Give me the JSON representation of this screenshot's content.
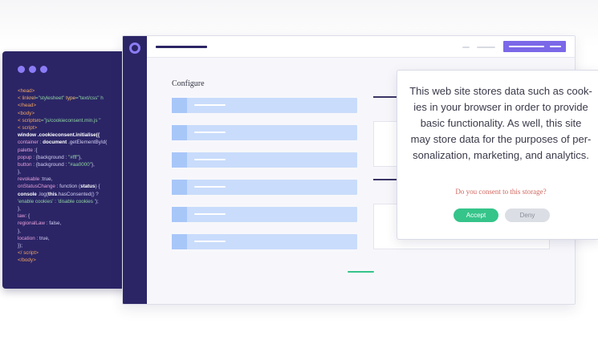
{
  "colors": {
    "navy": "#2b2566",
    "accent_purple": "#7b68e8",
    "dot_purple": "#8b7cf6",
    "row_blue": "#c9dcfb",
    "accept_green": "#35c48a",
    "deny_gray": "#dcdee5",
    "question_red": "#d0675e"
  },
  "code_editor": {
    "lines": [
      [
        {
          "t": "<head>",
          "c": "tag"
        }
      ],
      [
        {
          "t": "< ",
          "c": "tag"
        },
        {
          "t": "link",
          "c": "tag"
        },
        {
          "t": "rel",
          "c": "attr"
        },
        {
          "t": "=\"stylesheet\" ",
          "c": "str"
        },
        {
          "t": "type",
          "c": "attr"
        },
        {
          "t": "=\"text/css\" h",
          "c": "str"
        }
      ],
      [
        {
          "t": "</head>",
          "c": "tag"
        }
      ],
      [
        {
          "t": "<body>",
          "c": "tag"
        }
      ],
      [
        {
          "t": "< ",
          "c": "tag"
        },
        {
          "t": "script",
          "c": "tag"
        },
        {
          "t": "src",
          "c": "attr"
        },
        {
          "t": "=\"js/cookieconsent.min.js",
          "c": "str"
        },
        {
          "t": " \"",
          "c": "str"
        }
      ],
      [
        {
          "t": "< ",
          "c": "tag"
        },
        {
          "t": "script",
          "c": "tag"
        },
        {
          "t": ">",
          "c": "tag"
        }
      ],
      [
        {
          "t": "window",
          "c": "strong"
        },
        {
          "t": " .cookieconsent.initialise({",
          "c": "strong"
        }
      ],
      [
        {
          "t": "container",
          "c": "key"
        },
        {
          "t": " : ",
          "c": "plain"
        },
        {
          "t": "document",
          "c": "strong"
        },
        {
          "t": " .getElementById(",
          "c": "plain"
        }
      ],
      [
        {
          "t": "palette",
          "c": "key"
        },
        {
          "t": " :{",
          "c": "plain"
        }
      ],
      [
        {
          "t": "popup",
          "c": "key"
        },
        {
          "t": " : {background : ",
          "c": "plain"
        },
        {
          "t": "\"#fff\"",
          "c": "str"
        },
        {
          "t": "},",
          "c": "plain"
        }
      ],
      [
        {
          "t": "button",
          "c": "key"
        },
        {
          "t": " : {background : ",
          "c": "plain"
        },
        {
          "t": "\"#aa0000\"",
          "c": "str"
        },
        {
          "t": "},",
          "c": "plain"
        }
      ],
      [
        {
          "t": "},",
          "c": "plain"
        }
      ],
      [
        {
          "t": "revokable",
          "c": "key"
        },
        {
          "t": " :true,",
          "c": "plain"
        }
      ],
      [
        {
          "t": "onStatusChange",
          "c": "key"
        },
        {
          "t": " : function (",
          "c": "plain"
        },
        {
          "t": "status",
          "c": "strong"
        },
        {
          "t": ") {",
          "c": "plain"
        }
      ],
      [
        {
          "t": "console",
          "c": "strong"
        },
        {
          "t": " .log(",
          "c": "plain"
        },
        {
          "t": "this",
          "c": "strong"
        },
        {
          "t": ".hasConsented() ?",
          "c": "plain"
        }
      ],
      [
        {
          "t": "'enable cookies'",
          "c": "str"
        },
        {
          "t": " : ",
          "c": "plain"
        },
        {
          "t": "'disable cookies '",
          "c": "str"
        },
        {
          "t": ");",
          "c": "plain"
        }
      ],
      [
        {
          "t": "},",
          "c": "plain"
        }
      ],
      [
        {
          "t": "law",
          "c": "key"
        },
        {
          "t": ": {",
          "c": "plain"
        }
      ],
      [
        {
          "t": "regionalLaw",
          "c": "key"
        },
        {
          "t": " : false,",
          "c": "plain"
        }
      ],
      [
        {
          "t": "},",
          "c": "plain"
        }
      ],
      [
        {
          "t": "location",
          "c": "key"
        },
        {
          "t": " : true,",
          "c": "plain"
        }
      ],
      [
        {
          "t": "});",
          "c": "plain"
        }
      ],
      [
        {
          "t": "</ ",
          "c": "tag"
        },
        {
          "t": "script",
          "c": "tag"
        },
        {
          "t": ">",
          "c": "tag"
        }
      ],
      [
        {
          "t": "</body>",
          "c": "tag"
        }
      ]
    ]
  },
  "browser": {
    "configure_label": "Configure",
    "config_row_count": 6
  },
  "consent": {
    "message": "This web site stores data such as cook-ies in your browser in order to provide basic functionality. As well, this site may store data for the purposes of per-sonalization, marketing, and analytics.",
    "message_lines": [
      "This web site stores data such as cook-",
      "ies in your browser in order to provide",
      "basic functionality. As well, this site",
      "may store data for the purposes of per-",
      "sonalization, marketing, and analytics."
    ],
    "question": "Do you consent to this storage?",
    "accept_label": "Accept",
    "deny_label": "Deny"
  }
}
